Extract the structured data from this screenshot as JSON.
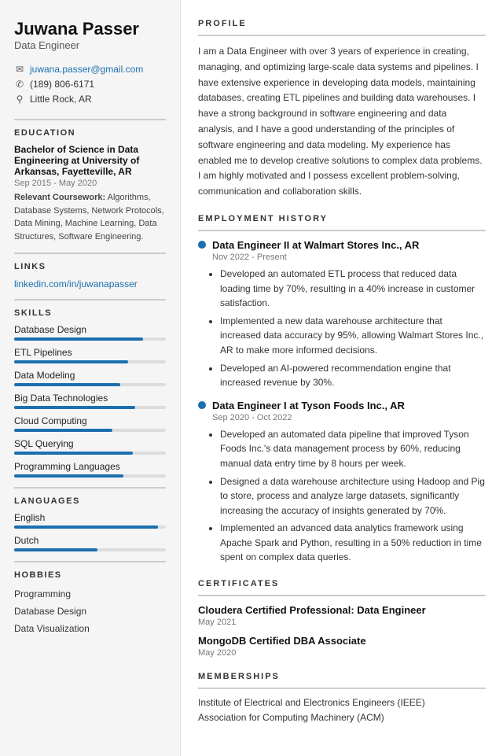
{
  "sidebar": {
    "name": "Juwana Passer",
    "title": "Data Engineer",
    "contact": {
      "email": "juwana.passer@gmail.com",
      "phone": "(189) 806-6171",
      "location": "Little Rock, AR"
    },
    "education": {
      "section_title": "EDUCATION",
      "degree": "Bachelor of Science in Data Engineering at University of Arkansas, Fayetteville, AR",
      "dates": "Sep 2015 - May 2020",
      "coursework_label": "Relevant Coursework:",
      "coursework": "Algorithms, Database Systems, Network Protocols, Data Mining, Machine Learning, Data Structures, Software Engineering."
    },
    "links": {
      "section_title": "LINKS",
      "linkedin": "linkedin.com/in/juwanapasser"
    },
    "skills": {
      "section_title": "SKILLS",
      "items": [
        {
          "label": "Database Design",
          "pct": 85
        },
        {
          "label": "ETL Pipelines",
          "pct": 75
        },
        {
          "label": "Data Modeling",
          "pct": 70
        },
        {
          "label": "Big Data Technologies",
          "pct": 80
        },
        {
          "label": "Cloud Computing",
          "pct": 65
        },
        {
          "label": "SQL Querying",
          "pct": 78
        },
        {
          "label": "Programming Languages",
          "pct": 72
        }
      ]
    },
    "languages": {
      "section_title": "LANGUAGES",
      "items": [
        {
          "label": "English",
          "pct": 95
        },
        {
          "label": "Dutch",
          "pct": 55
        }
      ]
    },
    "hobbies": {
      "section_title": "HOBBIES",
      "items": [
        "Programming",
        "Database Design",
        "Data Visualization"
      ]
    }
  },
  "main": {
    "profile": {
      "section_title": "PROFILE",
      "text": "I am a Data Engineer with over 3 years of experience in creating, managing, and optimizing large-scale data systems and pipelines. I have extensive experience in developing data models, maintaining databases, creating ETL pipelines and building data warehouses. I have a strong background in software engineering and data analysis, and I have a good understanding of the principles of software engineering and data modeling. My experience has enabled me to develop creative solutions to complex data problems. I am highly motivated and I possess excellent problem-solving, communication and collaboration skills."
    },
    "employment": {
      "section_title": "EMPLOYMENT HISTORY",
      "jobs": [
        {
          "title": "Data Engineer II at Walmart Stores Inc., AR",
          "dates": "Nov 2022 - Present",
          "bullets": [
            "Developed an automated ETL process that reduced data loading time by 70%, resulting in a 40% increase in customer satisfaction.",
            "Implemented a new data warehouse architecture that increased data accuracy by 95%, allowing Walmart Stores Inc., AR to make more informed decisions.",
            "Developed an AI-powered recommendation engine that increased revenue by 30%."
          ]
        },
        {
          "title": "Data Engineer I at Tyson Foods Inc., AR",
          "dates": "Sep 2020 - Oct 2022",
          "bullets": [
            "Developed an automated data pipeline that improved Tyson Foods Inc.'s data management process by 60%, reducing manual data entry time by 8 hours per week.",
            "Designed a data warehouse architecture using Hadoop and Pig to store, process and analyze large datasets, significantly increasing the accuracy of insights generated by 70%.",
            "Implemented an advanced data analytics framework using Apache Spark and Python, resulting in a 50% reduction in time spent on complex data queries."
          ]
        }
      ]
    },
    "certificates": {
      "section_title": "CERTIFICATES",
      "items": [
        {
          "name": "Cloudera Certified Professional: Data Engineer",
          "date": "May 2021"
        },
        {
          "name": "MongoDB Certified DBA Associate",
          "date": "May 2020"
        }
      ]
    },
    "memberships": {
      "section_title": "MEMBERSHIPS",
      "items": [
        "Institute of Electrical and Electronics Engineers (IEEE)",
        "Association for Computing Machinery (ACM)"
      ]
    }
  }
}
